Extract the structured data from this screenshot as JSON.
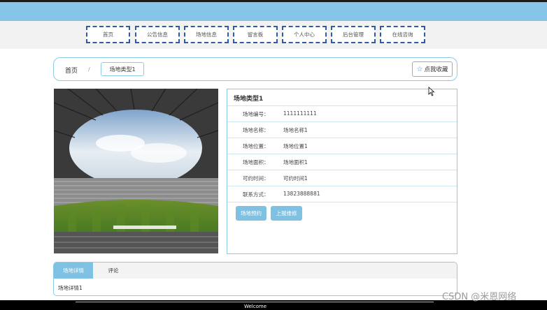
{
  "nav": {
    "items": [
      {
        "label": "首页"
      },
      {
        "label": "公告信息"
      },
      {
        "label": "场地信息"
      },
      {
        "label": "留言板"
      },
      {
        "label": "个人中心"
      },
      {
        "label": "后台管理"
      },
      {
        "label": "在线咨询"
      }
    ]
  },
  "breadcrumb": {
    "home": "首页",
    "separator": "/",
    "current": "场地类型1"
  },
  "favorite": {
    "icon": "star-icon",
    "label": "点我收藏"
  },
  "venue": {
    "title": "场地类型1",
    "fields": [
      {
        "label": "场地编号：",
        "value": "1111111111"
      },
      {
        "label": "场地名称：",
        "value": "场地名称1"
      },
      {
        "label": "场地位置：",
        "value": "场地位置1"
      },
      {
        "label": "场地面积：",
        "value": "场地面积1"
      },
      {
        "label": "可约时间：",
        "value": "可约时间1"
      },
      {
        "label": "联系方式：",
        "value": "13823888881"
      }
    ],
    "actions": {
      "book": "场地预约",
      "repair": "上报维修"
    }
  },
  "tabs": {
    "details": "场地详情",
    "comments": "评论",
    "content": "场地详情1"
  },
  "footer": {
    "text": "Welcome"
  },
  "watermark": "CSDN @米恩网络",
  "colors": {
    "header": "#87c5e8",
    "accent": "#7ec1e3",
    "nav_border": "#2f5aa8",
    "panel_border": "#8ccbe6"
  }
}
